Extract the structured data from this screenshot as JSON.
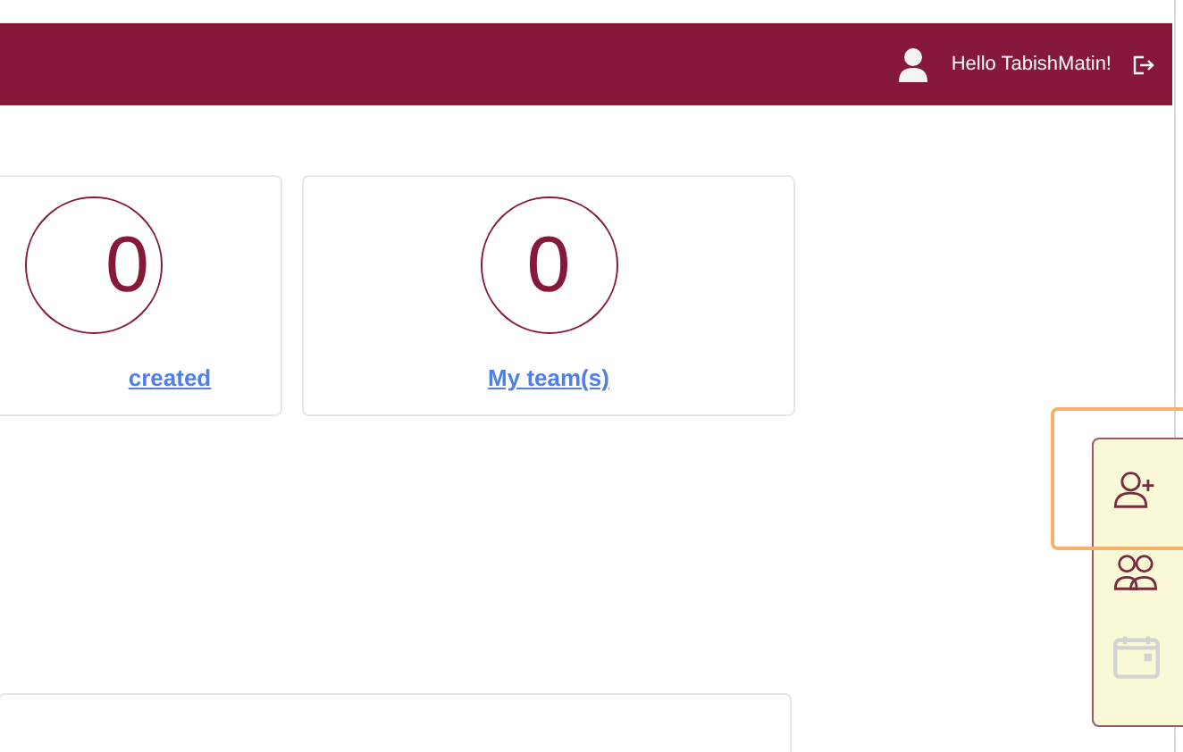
{
  "header": {
    "greeting": "Hello TabishMatin!"
  },
  "stats": [
    {
      "value": "0",
      "label": "created"
    },
    {
      "value": "0",
      "label": "My team(s)"
    }
  ],
  "side_panel": {
    "items": [
      {
        "kind": "add-user",
        "disabled": false
      },
      {
        "kind": "team",
        "disabled": false
      },
      {
        "kind": "calendar",
        "disabled": true
      }
    ]
  }
}
